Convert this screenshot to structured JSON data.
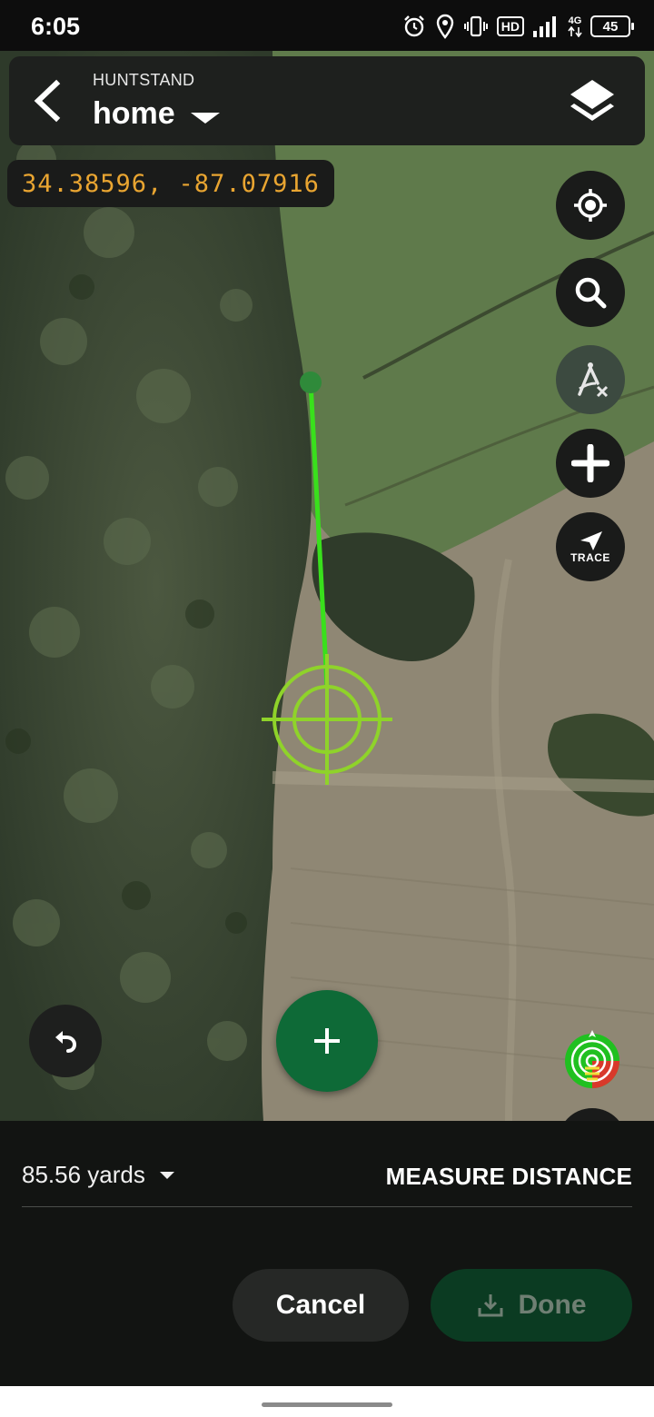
{
  "status_bar": {
    "time": "6:05",
    "hd_label": "HD",
    "network_label": "4G",
    "battery_level": "45",
    "icons": [
      "alarm-icon",
      "location-icon",
      "vibrate-icon",
      "hd-icon",
      "signal-icon",
      "battery-icon"
    ]
  },
  "header": {
    "provider": "HUNTSTAND",
    "map_name": "home",
    "back_icon": "back-arrow-icon",
    "layers_icon": "layers-icon"
  },
  "coordinates": "34.38596, -87.07916",
  "map_controls": [
    {
      "name": "locate-button",
      "icon": "crosshair-locate-icon"
    },
    {
      "name": "search-button",
      "icon": "search-icon"
    },
    {
      "name": "measure-button",
      "icon": "compass-measure-icon"
    },
    {
      "name": "add-button",
      "icon": "plus-icon"
    },
    {
      "name": "trace-button",
      "icon": "trace-arrow-icon",
      "label": "TRACE"
    }
  ],
  "measure": {
    "distance": "85.56 yards",
    "title": "MEASURE DISTANCE"
  },
  "buttons": {
    "cancel": "Cancel",
    "done": "Done"
  },
  "colors": {
    "measure_line": "#39e01c",
    "reticle": "#8fd32a",
    "coords_text": "#e9a531",
    "add_point": "#0e6a37",
    "done_bg": "#0b3b22"
  }
}
